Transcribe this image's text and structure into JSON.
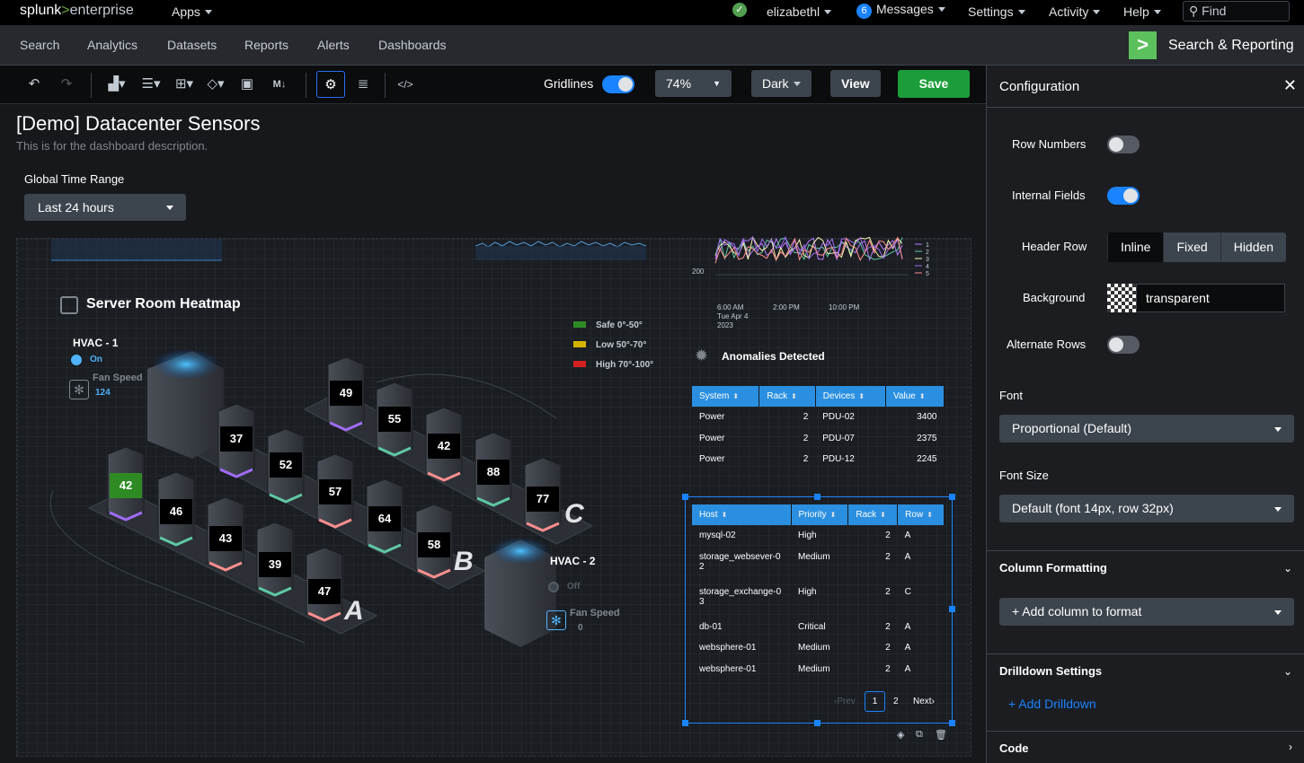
{
  "topbar": {
    "logo_left": "splunk",
    "logo_sep": ">",
    "logo_right": "enterprise",
    "apps": "Apps",
    "user": "elizabethl",
    "messages_count": "6",
    "messages": "Messages",
    "settings": "Settings",
    "activity": "Activity",
    "help": "Help",
    "find_placeholder": "Find"
  },
  "appbar": {
    "nav": [
      "Search",
      "Analytics",
      "Datasets",
      "Reports",
      "Alerts",
      "Dashboards"
    ],
    "app_title": "Search & Reporting"
  },
  "toolbar": {
    "gridlines_label": "Gridlines",
    "gridlines_on": true,
    "zoom": "74%",
    "theme": "Dark",
    "view": "View",
    "save": "Save"
  },
  "dashboard": {
    "title": "[Demo] Datacenter Sensors",
    "description": "This is for the dashboard description.",
    "time_range_label": "Global Time Range",
    "time_range_value": "Last 24 hours"
  },
  "heatmap": {
    "title": "Server Room Heatmap",
    "legend": [
      {
        "label": "Safe 0°-50°",
        "color": "#2e8b24"
      },
      {
        "label": "Low 50°-70°",
        "color": "#d4b400"
      },
      {
        "label": "High 70°-100°",
        "color": "#d41f1f"
      }
    ],
    "hvac1": {
      "name": "HVAC - 1",
      "status": "On",
      "fan_label": "Fan Speed",
      "fan_value": "124"
    },
    "hvac2": {
      "name": "HVAC - 2",
      "status": "Off",
      "fan_label": "Fan Speed",
      "fan_value": "0"
    },
    "rack_values": [
      "42",
      "46",
      "43",
      "39",
      "47",
      "37",
      "52",
      "57",
      "64",
      "58",
      "49",
      "55",
      "42",
      "88",
      "77"
    ],
    "row_letters": [
      "A",
      "B",
      "C"
    ]
  },
  "mini_chart": {
    "y_tick": "200",
    "x_ticks": [
      "6:00 AM",
      "2:00 PM",
      "10:00 PM"
    ],
    "x_sub": [
      "Tue Apr 4",
      "2023"
    ],
    "series_names": [
      "1",
      "2",
      "3",
      "4",
      "5"
    ],
    "series_colors": [
      "#b57bff",
      "#5ec8a3",
      "#fff7b0",
      "#a06cf5",
      "#ff8f8f"
    ]
  },
  "anomalies": {
    "title": "Anomalies Detected",
    "columns": [
      "System",
      "Rack",
      "Devices",
      "Value"
    ],
    "rows": [
      [
        "Power",
        "2",
        "PDU-02",
        "3400"
      ],
      [
        "Power",
        "2",
        "PDU-07",
        "2375"
      ],
      [
        "Power",
        "2",
        "PDU-12",
        "2245"
      ]
    ]
  },
  "host_table": {
    "columns": [
      "Host",
      "Priority",
      "Rack",
      "Row"
    ],
    "rows": [
      [
        "mysql-02",
        "High",
        "2",
        "A"
      ],
      [
        "storage_websever-02",
        "Medium",
        "2",
        "A"
      ],
      [
        "storage_exchange-03",
        "High",
        "2",
        "C"
      ],
      [
        "db-01",
        "Critical",
        "2",
        "A"
      ],
      [
        "websphere-01",
        "Medium",
        "2",
        "A"
      ],
      [
        "websphere-01",
        "Medium",
        "2",
        "A"
      ]
    ],
    "prev": "Prev",
    "pages": [
      "1",
      "2"
    ],
    "next": "Next"
  },
  "config": {
    "title": "Configuration",
    "row_numbers": "Row Numbers",
    "internal_fields": "Internal Fields",
    "header_row": "Header Row",
    "header_options": [
      "Inline",
      "Fixed",
      "Hidden"
    ],
    "background": "Background",
    "background_value": "transparent",
    "alternate_rows": "Alternate Rows",
    "font": "Font",
    "font_value": "Proportional (Default)",
    "font_size": "Font Size",
    "font_size_value": "Default (font 14px, row 32px)",
    "column_formatting": "Column Formatting",
    "add_column": "+ Add column to format",
    "drilldown_settings": "Drilldown Settings",
    "add_drilldown": "+ Add Drilldown",
    "code": "Code"
  }
}
